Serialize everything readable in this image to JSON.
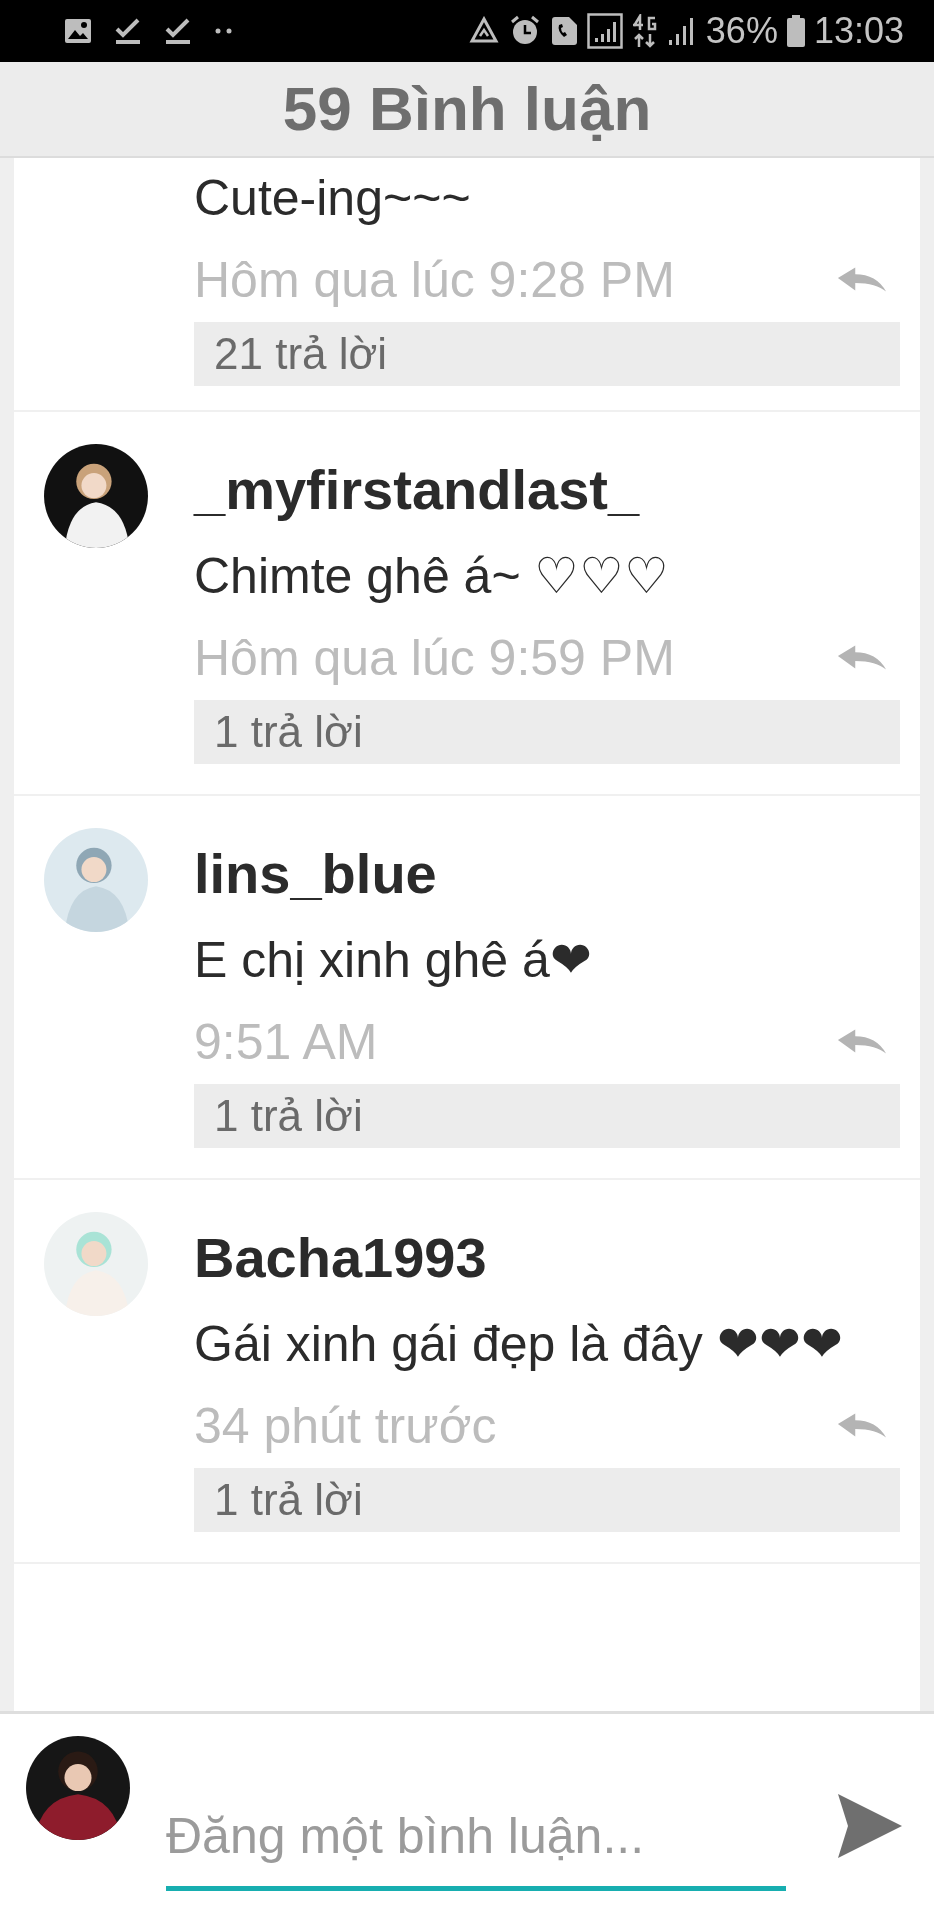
{
  "status_bar": {
    "battery": "36%",
    "time": "13:03"
  },
  "header": {
    "title": "59 Bình luận"
  },
  "comments": [
    {
      "text": "Cute-ing~~~",
      "time": "Hôm qua lúc 9:28 PM",
      "replies": "21 trả lời"
    },
    {
      "username": "_myfirstandlast_",
      "text": "Chimte ghê á~ ♡♡♡",
      "time": "Hôm qua lúc 9:59 PM",
      "replies": "1 trả lời"
    },
    {
      "username": "lins_blue",
      "text": "E chị xinh ghê á❤",
      "time": "9:51 AM",
      "replies": "1 trả lời"
    },
    {
      "username": "Bacha1993",
      "text": "Gái xinh gái đẹp là đây ❤❤❤",
      "time": "34 phút trước",
      "replies": "1 trả lời"
    }
  ],
  "composer": {
    "placeholder": "Đăng một bình luận..."
  }
}
